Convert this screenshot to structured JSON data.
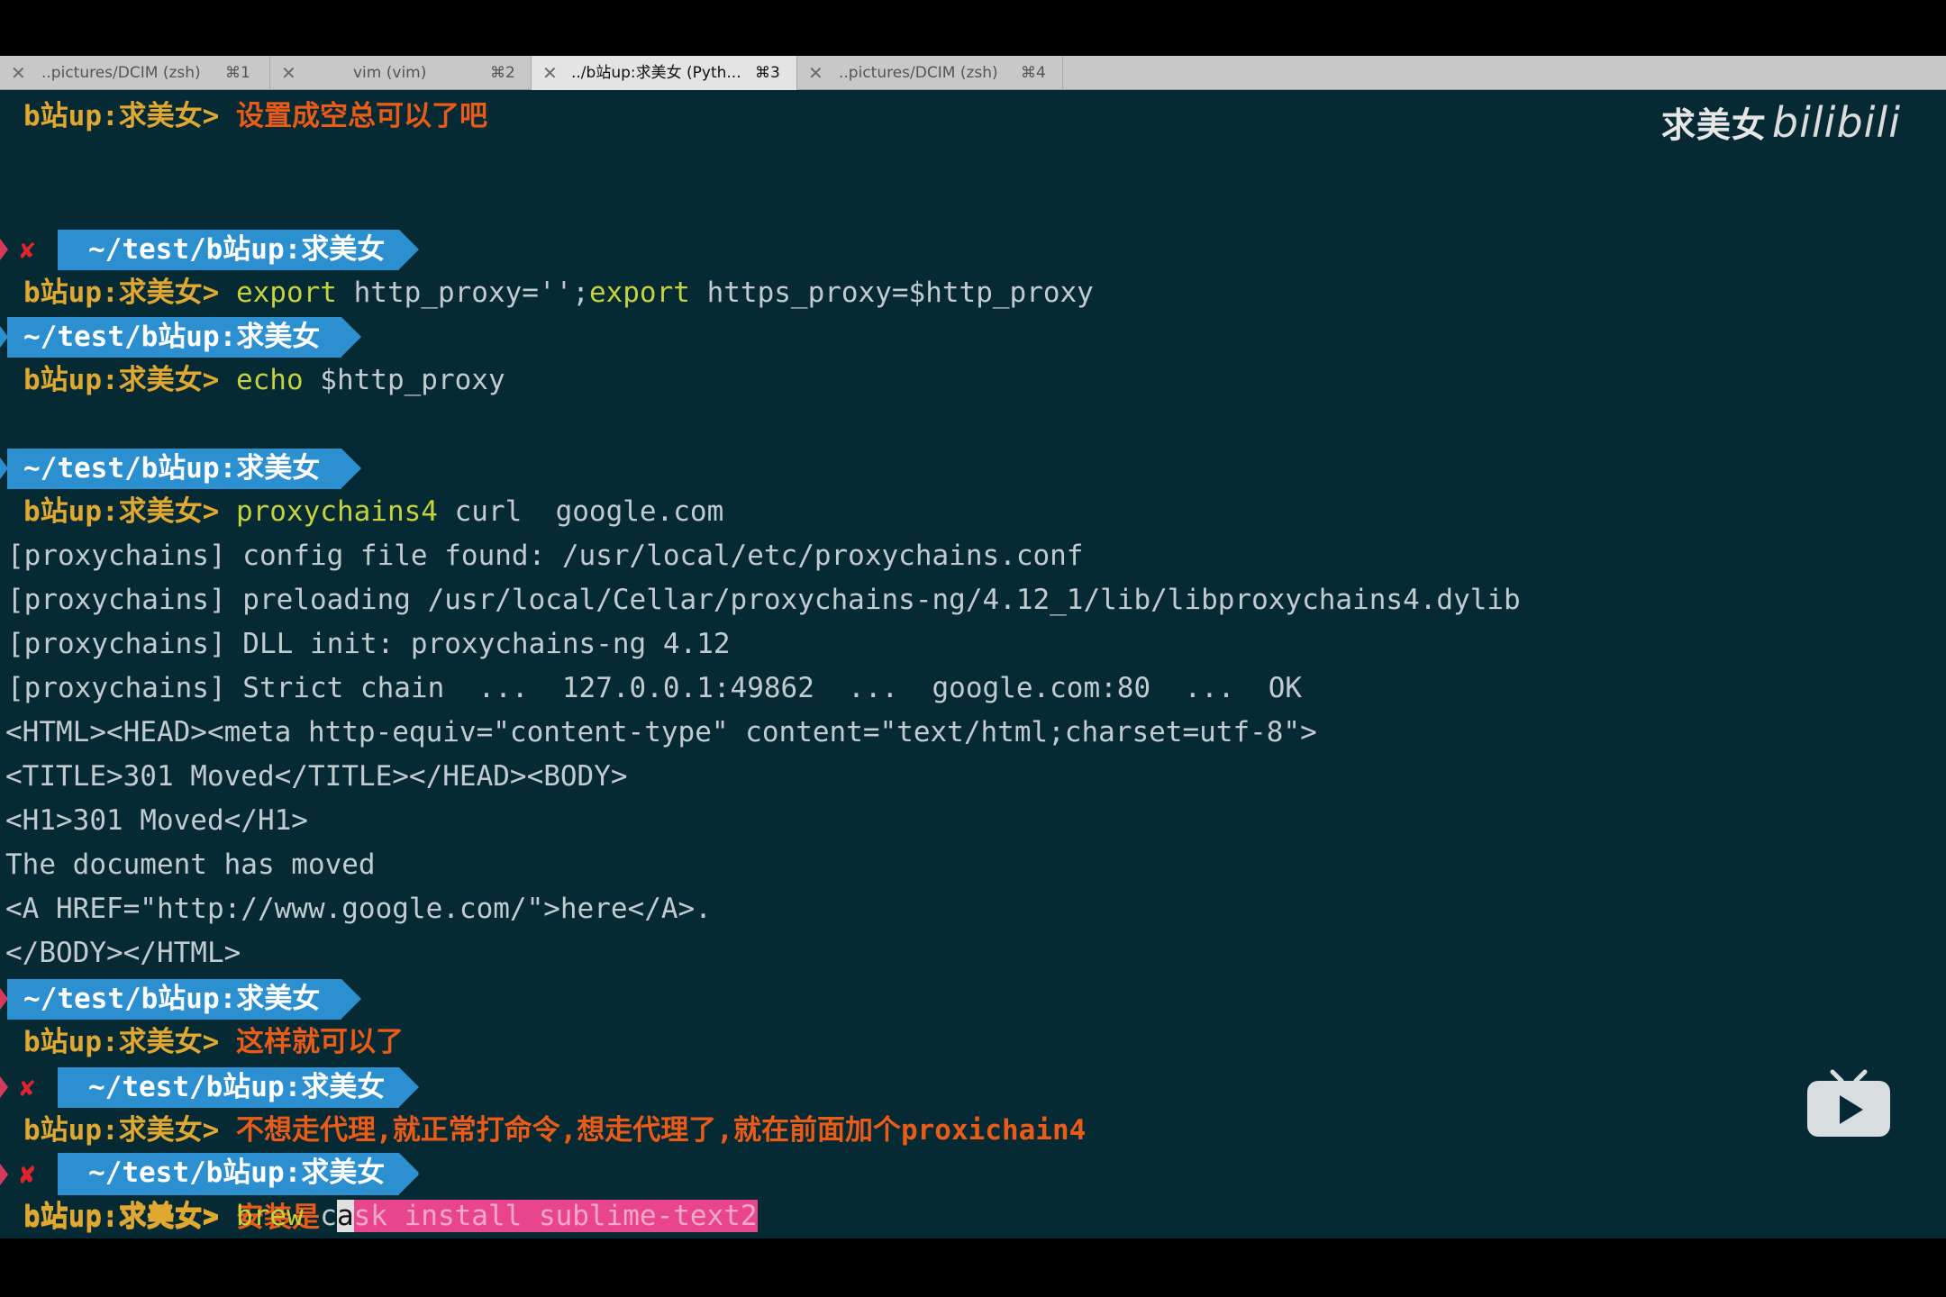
{
  "tabs": [
    {
      "label": "..pictures/DCIM (zsh)",
      "shortcut": "⌘1",
      "active": false
    },
    {
      "label": "vim (vim)",
      "shortcut": "⌘2",
      "active": false
    },
    {
      "label": "../b站up:求美女 (Pyth...",
      "shortcut": "⌘3",
      "active": true
    },
    {
      "label": "..pictures/DCIM (zsh)",
      "shortcut": "⌘4",
      "active": false
    }
  ],
  "watermark": {
    "text": "求美女",
    "brand": "bilibili"
  },
  "prompt": {
    "user": "b站up:求美女> ",
    "path": "~/test/b站up:求美女",
    "error_mark": "✘"
  },
  "lines": {
    "l1_comment": "设置成空总可以了吧",
    "l3_kw1": "export",
    "l3_arg1": " http_proxy='';",
    "l3_kw2": "export",
    "l3_arg2": " https_proxy=$http_proxy",
    "l5_kw": "echo",
    "l5_arg": " $http_proxy",
    "l8_kw": "proxychains4",
    "l8_arg": " curl  google.com",
    "o1": "[proxychains] config file found: /usr/local/etc/proxychains.conf",
    "o2": "[proxychains] preloading /usr/local/Cellar/proxychains-ng/4.12_1/lib/libproxychains4.dylib",
    "o3": "[proxychains] DLL init: proxychains-ng 4.12",
    "o4": "[proxychains] Strict chain  ...  127.0.0.1:49862  ...  google.com:80  ...  OK",
    "o5": "<HTML><HEAD><meta http-equiv=\"content-type\" content=\"text/html;charset=utf-8\">",
    "o6": "<TITLE>301 Moved</TITLE></HEAD><BODY>",
    "o7": "<H1>301 Moved</H1>",
    "o8": "The document has moved",
    "o9": "<A HREF=\"http://www.google.com/\">here</A>.",
    "o10": "</BODY></HTML>",
    "c2": "这样就可以了",
    "c3": "不想走代理,就正常打命令,想走代理了,就在前面加个proxichain4",
    "c4": "安装是",
    "last_kw": "brew",
    "last_pre": " c",
    "last_cursor": "a",
    "last_sel": "sk install sublime-text2"
  }
}
